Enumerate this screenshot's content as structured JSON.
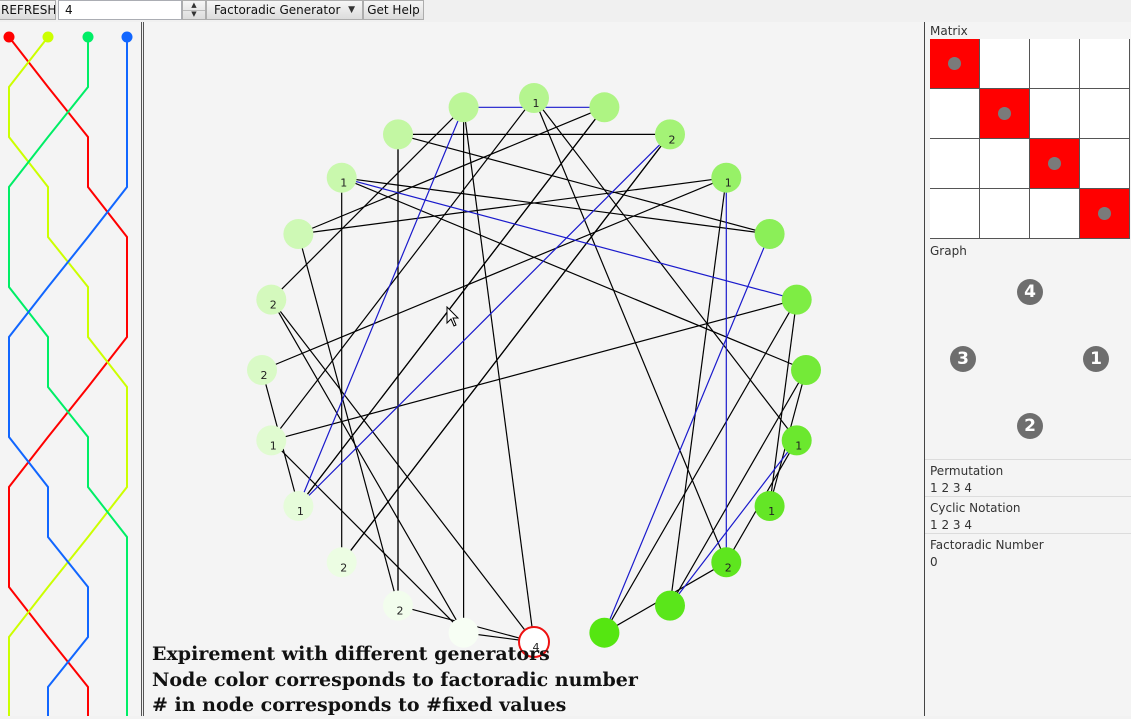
{
  "toolbar": {
    "refresh_label": "REFRESH",
    "n_value": "4",
    "generator_selected": "Factoradic Generator",
    "help_label": "Get Help"
  },
  "left_panel": {
    "strands": [
      {
        "color": "#ff0000",
        "icon": "circle"
      },
      {
        "color": "#ccff00",
        "icon": "circle"
      },
      {
        "color": "#00ee66",
        "icon": "circle"
      },
      {
        "color": "#1166ff",
        "icon": "circle"
      }
    ]
  },
  "graph": {
    "nodes": [
      {
        "label": "4",
        "fill": "#ffffff",
        "stroke": "#ee1111"
      },
      {
        "label": "",
        "fill": "#55e611",
        "stroke": ""
      },
      {
        "label": "",
        "fill": "#5ae61a",
        "stroke": ""
      },
      {
        "label": "2",
        "fill": "#5ee61e",
        "stroke": ""
      },
      {
        "label": "1",
        "fill": "#64e626",
        "stroke": ""
      },
      {
        "label": "1",
        "fill": "#6be82e",
        "stroke": ""
      },
      {
        "label": "",
        "fill": "#74ea38",
        "stroke": ""
      },
      {
        "label": "",
        "fill": "#7eed44",
        "stroke": ""
      },
      {
        "label": "",
        "fill": "#8bef58",
        "stroke": ""
      },
      {
        "label": "1",
        "fill": "#97f167",
        "stroke": ""
      },
      {
        "label": "2",
        "fill": "#a4f376",
        "stroke": ""
      },
      {
        "label": "",
        "fill": "#aef483",
        "stroke": ""
      },
      {
        "label": "1",
        "fill": "#b5f58f",
        "stroke": ""
      },
      {
        "label": "",
        "fill": "#bcf698",
        "stroke": ""
      },
      {
        "label": "",
        "fill": "#c3f7a3",
        "stroke": ""
      },
      {
        "label": "1",
        "fill": "#c9f8ad",
        "stroke": ""
      },
      {
        "label": "",
        "fill": "#cef9b5",
        "stroke": ""
      },
      {
        "label": "2",
        "fill": "#d4f9bd",
        "stroke": ""
      },
      {
        "label": "2",
        "fill": "#d9fac6",
        "stroke": ""
      },
      {
        "label": "1",
        "fill": "#e0fbd0",
        "stroke": ""
      },
      {
        "label": "1",
        "fill": "#e6fcda",
        "stroke": ""
      },
      {
        "label": "2",
        "fill": "#ecfde3",
        "stroke": ""
      },
      {
        "label": "2",
        "fill": "#f2fded",
        "stroke": ""
      },
      {
        "label": "",
        "fill": "#f7fef4",
        "stroke": ""
      }
    ],
    "edges_black": [
      [
        0,
        13
      ],
      [
        0,
        17
      ],
      [
        0,
        22
      ],
      [
        0,
        23
      ],
      [
        1,
        7
      ],
      [
        1,
        3
      ],
      [
        2,
        9
      ],
      [
        2,
        6
      ],
      [
        3,
        12
      ],
      [
        4,
        7
      ],
      [
        5,
        12
      ],
      [
        5,
        3
      ],
      [
        6,
        15
      ],
      [
        7,
        19
      ],
      [
        8,
        14
      ],
      [
        9,
        18
      ],
      [
        10,
        21
      ],
      [
        10,
        14
      ],
      [
        11,
        16
      ],
      [
        11,
        20
      ],
      [
        12,
        19
      ],
      [
        13,
        23
      ],
      [
        14,
        22
      ],
      [
        15,
        21
      ],
      [
        16,
        22
      ],
      [
        17,
        23
      ],
      [
        18,
        20
      ],
      [
        19,
        23
      ],
      [
        20,
        11
      ],
      [
        21,
        10
      ],
      [
        22,
        14
      ],
      [
        4,
        6
      ],
      [
        8,
        15
      ],
      [
        9,
        16
      ],
      [
        13,
        17
      ]
    ],
    "edges_blue": [
      [
        2,
        5
      ],
      [
        1,
        8
      ],
      [
        7,
        15
      ],
      [
        10,
        20
      ],
      [
        11,
        13
      ],
      [
        13,
        20
      ],
      [
        3,
        9
      ]
    ],
    "captions": [
      "Expirement with different generators",
      "Node color corresponds to factoradic number",
      "# in node corresponds to #fixed values"
    ]
  },
  "right_panel": {
    "matrix_title": "Matrix",
    "matrix": {
      "size": 4,
      "perm": [
        1,
        2,
        3,
        4
      ],
      "on_color": "#ff0000"
    },
    "graph_title": "Graph",
    "graph_nodes": [
      "4",
      "3",
      "1",
      "2"
    ],
    "permutation_title": "Permutation",
    "permutation_value": "1 2 3 4",
    "cyclic_title": "Cyclic Notation",
    "cyclic_value": "1 2 3 4",
    "factoradic_title": "Factoradic Number",
    "factoradic_value": "0"
  }
}
